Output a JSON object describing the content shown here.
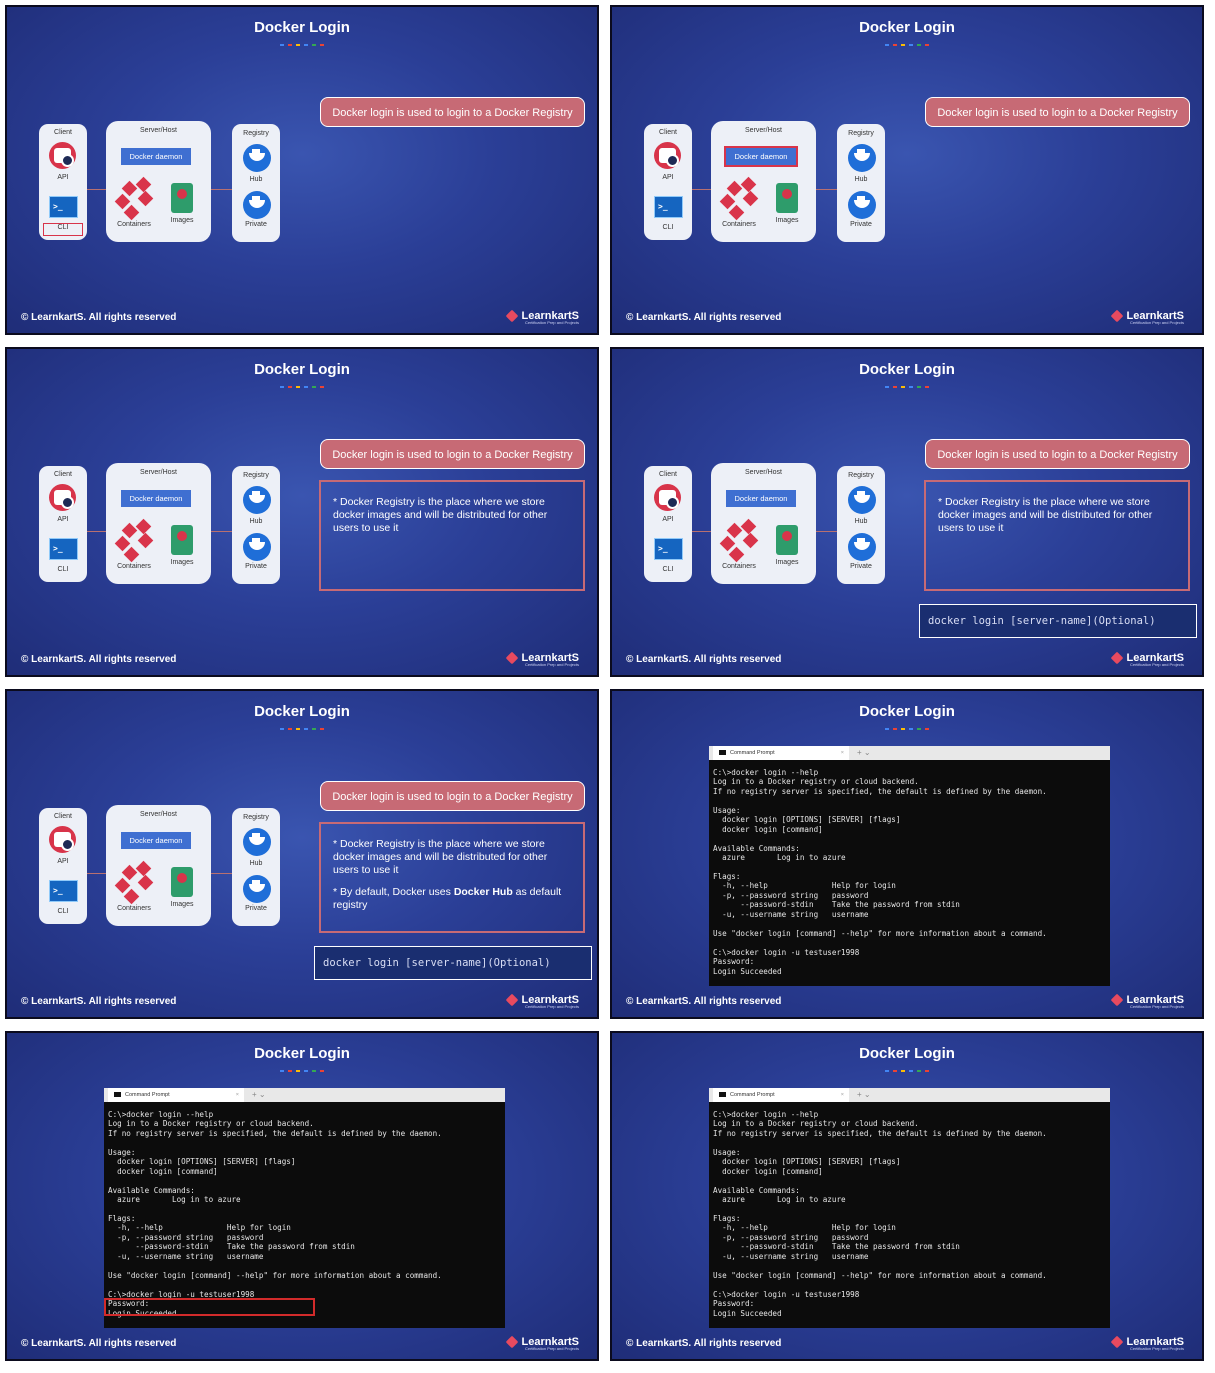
{
  "title": "Docker Login",
  "footer": {
    "copyright": "© LearnkartS. All rights reserved",
    "brand": "LearnkartS",
    "tagline": "Certification Prep and Projects"
  },
  "dots_colors": [
    "#4285f4",
    "#ea4335",
    "#fbbc05",
    "#4285f4",
    "#34a853",
    "#ea4335"
  ],
  "diagram": {
    "client": {
      "label": "Client",
      "api": "API",
      "cli": "CLI"
    },
    "server": {
      "label": "Server/Host",
      "daemon": "Docker daemon",
      "containers": "Containers",
      "images": "Images"
    },
    "registry": {
      "label": "Registry",
      "hub": "Hub",
      "private": "Private"
    }
  },
  "callout": "Docker login is used to login to a Docker Registry",
  "info": {
    "point1": "* Docker Registry is the place where we store docker images and will be distributed for other users to use it",
    "point2_prefix": "* By default, Docker uses ",
    "point2_bold": "Docker Hub",
    "point2_suffix": " as default registry"
  },
  "command": "docker login [server-name](Optional)",
  "terminal": {
    "tab_title": "Command Prompt",
    "tab_close": "×",
    "new_tab": "+  ⌄",
    "output": "C:\\>docker login --help\nLog in to a Docker registry or cloud backend.\nIf no registry server is specified, the default is defined by the daemon.\n\nUsage:\n  docker login [OPTIONS] [SERVER] [flags]\n  docker login [command]\n\nAvailable Commands:\n  azure       Log in to azure\n\nFlags:\n  -h, --help              Help for login\n  -p, --password string   password\n      --password-stdin    Take the password from stdin\n  -u, --username string   username\n\nUse \"docker login [command] --help\" for more information about a command.\n\nC:\\>docker login -u testuser1998\nPassword:\nLogin Succeeded"
  }
}
